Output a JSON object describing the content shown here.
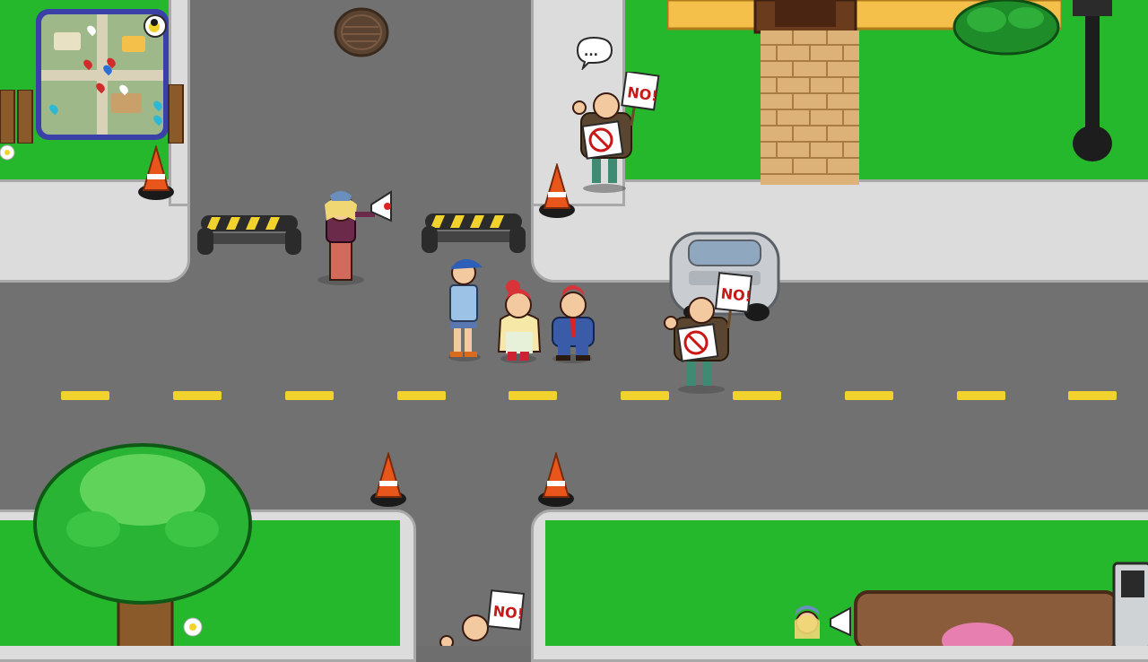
{
  "game": {
    "scene": "street-intersection",
    "protest_signs": [
      {
        "id": "sign-1",
        "text": "NO!"
      },
      {
        "id": "sign-2",
        "text": "NO!"
      },
      {
        "id": "sign-3",
        "text": "NO!"
      }
    ],
    "speech_bubble": {
      "text": "..."
    },
    "colors": {
      "grass": "#26b82c",
      "road": "#717171",
      "sidewalk": "#dcdcdc",
      "lane_marking": "#f2d22c",
      "cone": "#e8561c",
      "minimap_frame": "#3b3fa8",
      "sign_text": "#c81818"
    },
    "minimap": {
      "icons": [
        "home-pin-icon",
        "quest-pin-red-icon",
        "quest-pin-blue-icon",
        "quest-pin-white-icon",
        "duck-icon"
      ]
    }
  }
}
